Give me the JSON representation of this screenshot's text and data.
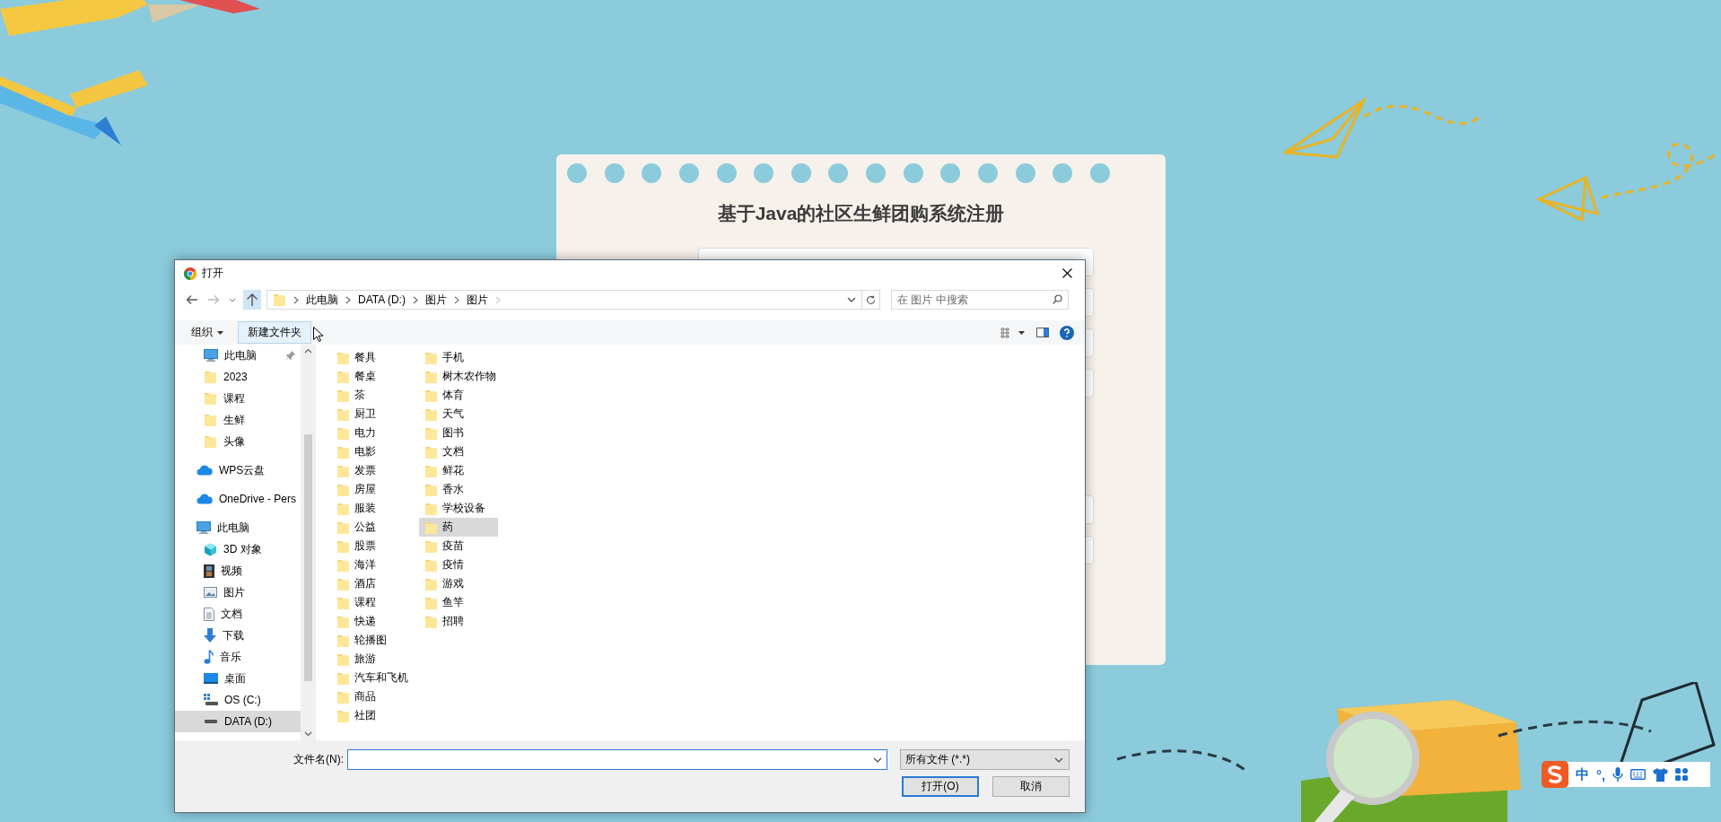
{
  "page": {
    "title": "基于Java的社区生鲜团购系统注册"
  },
  "dialog": {
    "title": "打开",
    "breadcrumb": [
      "此电脑",
      "DATA (D:)",
      "图片",
      "图片"
    ],
    "search": {
      "placeholder": "在 图片 中搜索"
    },
    "toolbar": {
      "organize": "组织",
      "new_folder": "新建文件夹"
    },
    "quick_access": [
      {
        "label": "此电脑",
        "kind": "pc",
        "pinned": true,
        "selected": false
      },
      {
        "label": "2023",
        "kind": "folder",
        "pinned": false,
        "selected": false
      },
      {
        "label": "课程",
        "kind": "folder",
        "pinned": false,
        "selected": false
      },
      {
        "label": "生鲜",
        "kind": "folder",
        "pinned": false,
        "selected": false
      },
      {
        "label": "头像",
        "kind": "folder",
        "pinned": false,
        "selected": false
      }
    ],
    "nav": [
      {
        "label": "WPS云盘",
        "kind": "cloud",
        "selected": false
      },
      {
        "label": "OneDrive - Pers",
        "kind": "cloud",
        "selected": false
      },
      {
        "label": "此电脑",
        "kind": "pc",
        "selected": false,
        "children": [
          {
            "label": "3D 对象",
            "kind": "cube",
            "selected": false
          },
          {
            "label": "视频",
            "kind": "video",
            "selected": false
          },
          {
            "label": "图片",
            "kind": "picture",
            "selected": false
          },
          {
            "label": "文档",
            "kind": "document",
            "selected": false
          },
          {
            "label": "下载",
            "kind": "download",
            "selected": false
          },
          {
            "label": "音乐",
            "kind": "music",
            "selected": false
          },
          {
            "label": "桌面",
            "kind": "desktop",
            "selected": false
          },
          {
            "label": "OS (C:)",
            "kind": "os-drive",
            "selected": false
          },
          {
            "label": "DATA (D:)",
            "kind": "drive",
            "selected": true
          }
        ]
      }
    ],
    "files": [
      {
        "name": "餐具",
        "selected": false
      },
      {
        "name": "餐桌",
        "selected": false
      },
      {
        "name": "茶",
        "selected": false
      },
      {
        "name": "厨卫",
        "selected": false
      },
      {
        "name": "电力",
        "selected": false
      },
      {
        "name": "电影",
        "selected": false
      },
      {
        "name": "发票",
        "selected": false
      },
      {
        "name": "房屋",
        "selected": false
      },
      {
        "name": "服装",
        "selected": false
      },
      {
        "name": "公益",
        "selected": false
      },
      {
        "name": "股票",
        "selected": false
      },
      {
        "name": "海洋",
        "selected": false
      },
      {
        "name": "酒店",
        "selected": false
      },
      {
        "name": "课程",
        "selected": false
      },
      {
        "name": "快递",
        "selected": false
      },
      {
        "name": "轮播图",
        "selected": false
      },
      {
        "name": "旅游",
        "selected": false
      },
      {
        "name": "汽车和飞机",
        "selected": false
      },
      {
        "name": "商品",
        "selected": false
      },
      {
        "name": "社团",
        "selected": false
      },
      {
        "name": "手机",
        "selected": false
      },
      {
        "name": "树木农作物",
        "selected": false
      },
      {
        "name": "体育",
        "selected": false
      },
      {
        "name": "天气",
        "selected": false
      },
      {
        "name": "图书",
        "selected": false
      },
      {
        "name": "文档",
        "selected": false
      },
      {
        "name": "鲜花",
        "selected": false
      },
      {
        "name": "香水",
        "selected": false
      },
      {
        "name": "学校设备",
        "selected": false
      },
      {
        "name": "药",
        "selected": true
      },
      {
        "name": "疫苗",
        "selected": false
      },
      {
        "name": "疫情",
        "selected": false
      },
      {
        "name": "游戏",
        "selected": false
      },
      {
        "name": "鱼竿",
        "selected": false
      },
      {
        "name": "招聘",
        "selected": false
      }
    ],
    "filename_label": "文件名(N):",
    "filter": "所有文件 (*.*)",
    "buttons": {
      "open": "打开(O)",
      "cancel": "取消"
    }
  },
  "ime": {
    "mode": "中",
    "punctuation": "°,"
  }
}
